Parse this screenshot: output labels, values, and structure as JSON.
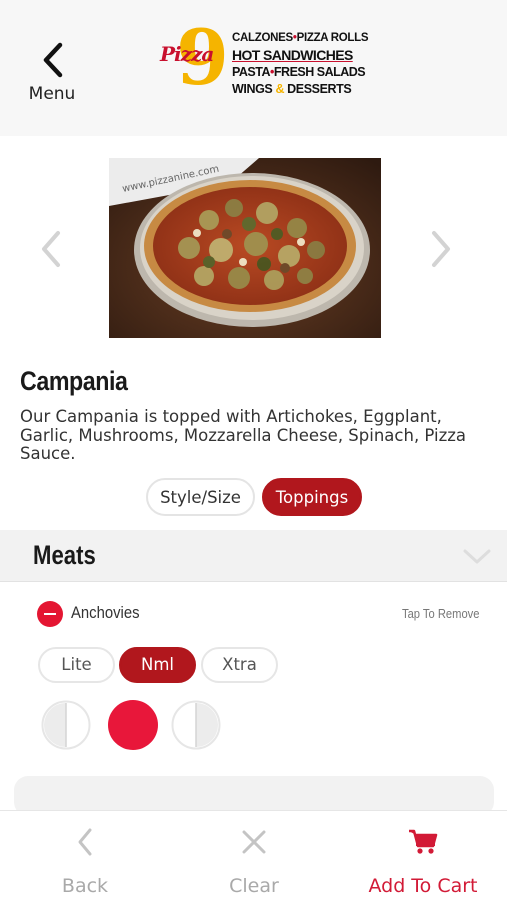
{
  "header": {
    "menu_label": "Menu",
    "logo": {
      "brand_word": "Pizza",
      "brand_number": "9",
      "tagline_lines": [
        [
          "CALZONES",
          "•",
          "PIZZA ROLLS"
        ],
        [
          "HOT SANDWICHES"
        ],
        [
          "PASTA",
          "•",
          "FRESH SALADS"
        ],
        [
          "WINGS",
          "&",
          "DESSERTS"
        ]
      ],
      "photo_box_text": "www.pizzanine.com"
    }
  },
  "item": {
    "title": "Campania",
    "description": "Our Campania is topped with Artichokes, Eggplant, Garlic, Mushrooms, Mozzarella Cheese, Spinach, Pizza Sauce."
  },
  "tabs": {
    "style_size": "Style/Size",
    "toppings": "Toppings",
    "active": "toppings"
  },
  "section": {
    "title": "Meats",
    "topping": {
      "name": "Anchovies",
      "hint": "Tap To Remove",
      "amounts": [
        "Lite",
        "Nml",
        "Xtra"
      ],
      "selected_amount": "Nml",
      "portions": [
        "left-half",
        "whole",
        "right-half"
      ],
      "selected_portion": "whole"
    }
  },
  "bottom_bar": {
    "back": "Back",
    "clear": "Clear",
    "add_to_cart": "Add To Cart"
  },
  "colors": {
    "brand_red": "#b1171d",
    "accent_red": "#e41632",
    "logo_yellow": "#f5b400",
    "muted_gray": "#a9a9a9",
    "header_bg": "#f7f7f7"
  },
  "icons": {
    "menu": "chevron-left-icon",
    "carousel_prev": "chevron-left-icon",
    "carousel_next": "chevron-right-icon",
    "section_toggle": "chevron-down-icon",
    "remove": "minus-circle-icon",
    "back": "chevron-left-icon",
    "clear": "close-icon",
    "cart": "cart-icon"
  }
}
